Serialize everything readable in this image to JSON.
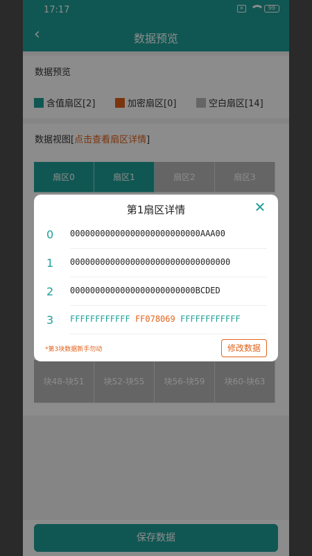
{
  "status_bar": {
    "time": "17:17",
    "sim_icon": "sim-x-icon",
    "wifi_icon": "wifi-icon",
    "battery": "99"
  },
  "header": {
    "title": "数据预览",
    "back_icon": "chevron-left-icon"
  },
  "preview": {
    "heading": "数据预览",
    "legend": [
      {
        "label": "含值扇区[2]",
        "color": "#1e9e98"
      },
      {
        "label": "加密扇区[0]",
        "color": "#e0621b"
      },
      {
        "label": "空白扇区[14]",
        "color": "#b9b9b9"
      }
    ]
  },
  "view": {
    "heading_prefix": "数据视图[",
    "heading_link": "点击查看扇区详情",
    "heading_suffix": "]",
    "sectors_top": [
      "扇区0",
      "扇区1",
      "扇区2",
      "扇区3"
    ],
    "blocks_bottom": [
      "块48-块51",
      "块52-块55",
      "块56-块59",
      "块60-块63"
    ]
  },
  "dialog": {
    "title": "第1扇区详情",
    "close_icon": "close-icon",
    "rows": [
      {
        "index": "0",
        "data": "00000000000000000000000000AAA00"
      },
      {
        "index": "1",
        "data": "00000000000000000000000000000000"
      },
      {
        "index": "2",
        "data": "0000000000000000000000000BCDED"
      },
      {
        "index": "3",
        "part1": "FFFFFFFFFFFF",
        "part2": "FF078069",
        "part3": "FFFFFFFFFFFF"
      }
    ],
    "note": "*第3块数据新手勿动",
    "edit_button": "修改数据"
  },
  "footer": {
    "save_button": "保存数据"
  }
}
